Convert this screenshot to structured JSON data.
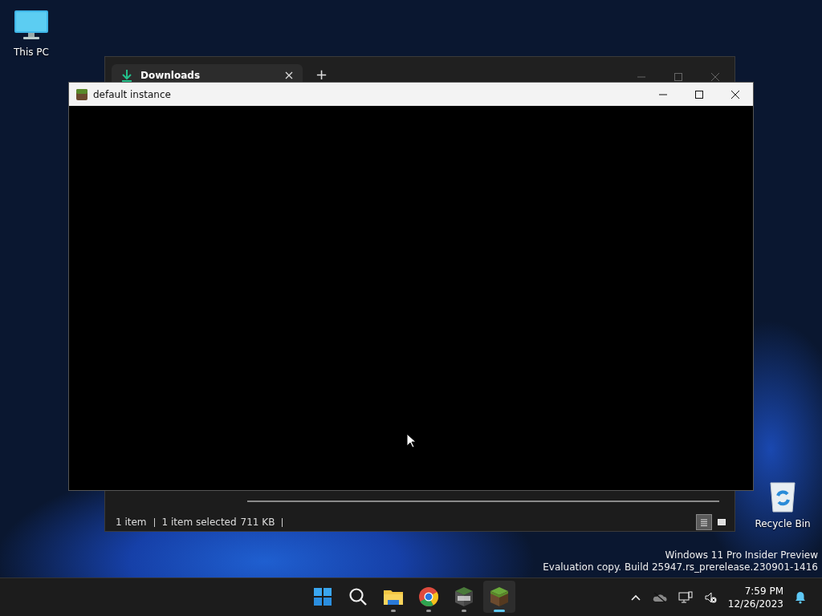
{
  "desktop_icons": [
    {
      "label": "This PC",
      "kind": "pc"
    },
    {
      "label": "Recycle Bin",
      "kind": "bin"
    }
  ],
  "explorer": {
    "tab": {
      "title": "Downloads",
      "selected": true
    },
    "new_tab": "+",
    "status": {
      "items": "1 item",
      "selected": "1 item selected",
      "size": "711 KB"
    },
    "views": [
      {
        "kind": "details",
        "selected": true
      },
      {
        "kind": "thumbnails",
        "selected": false
      }
    ]
  },
  "game_window": {
    "title": "default instance"
  },
  "os_notice": [
    "Windows 11 Pro Insider Preview",
    "Evaluation copy. Build 25947.rs_prerelease.230901-1416"
  ],
  "taskbar": {
    "apps": [
      {
        "kind": "start",
        "running": false,
        "selected": false
      },
      {
        "kind": "search",
        "running": false,
        "selected": false
      },
      {
        "kind": "folder",
        "running": true,
        "selected": false
      },
      {
        "kind": "browser",
        "running": true,
        "selected": false
      },
      {
        "kind": "launcher",
        "running": true,
        "selected": false
      },
      {
        "kind": "game",
        "running": true,
        "selected": true
      }
    ],
    "time": "7:59 PM",
    "date": "12/26/2023"
  }
}
